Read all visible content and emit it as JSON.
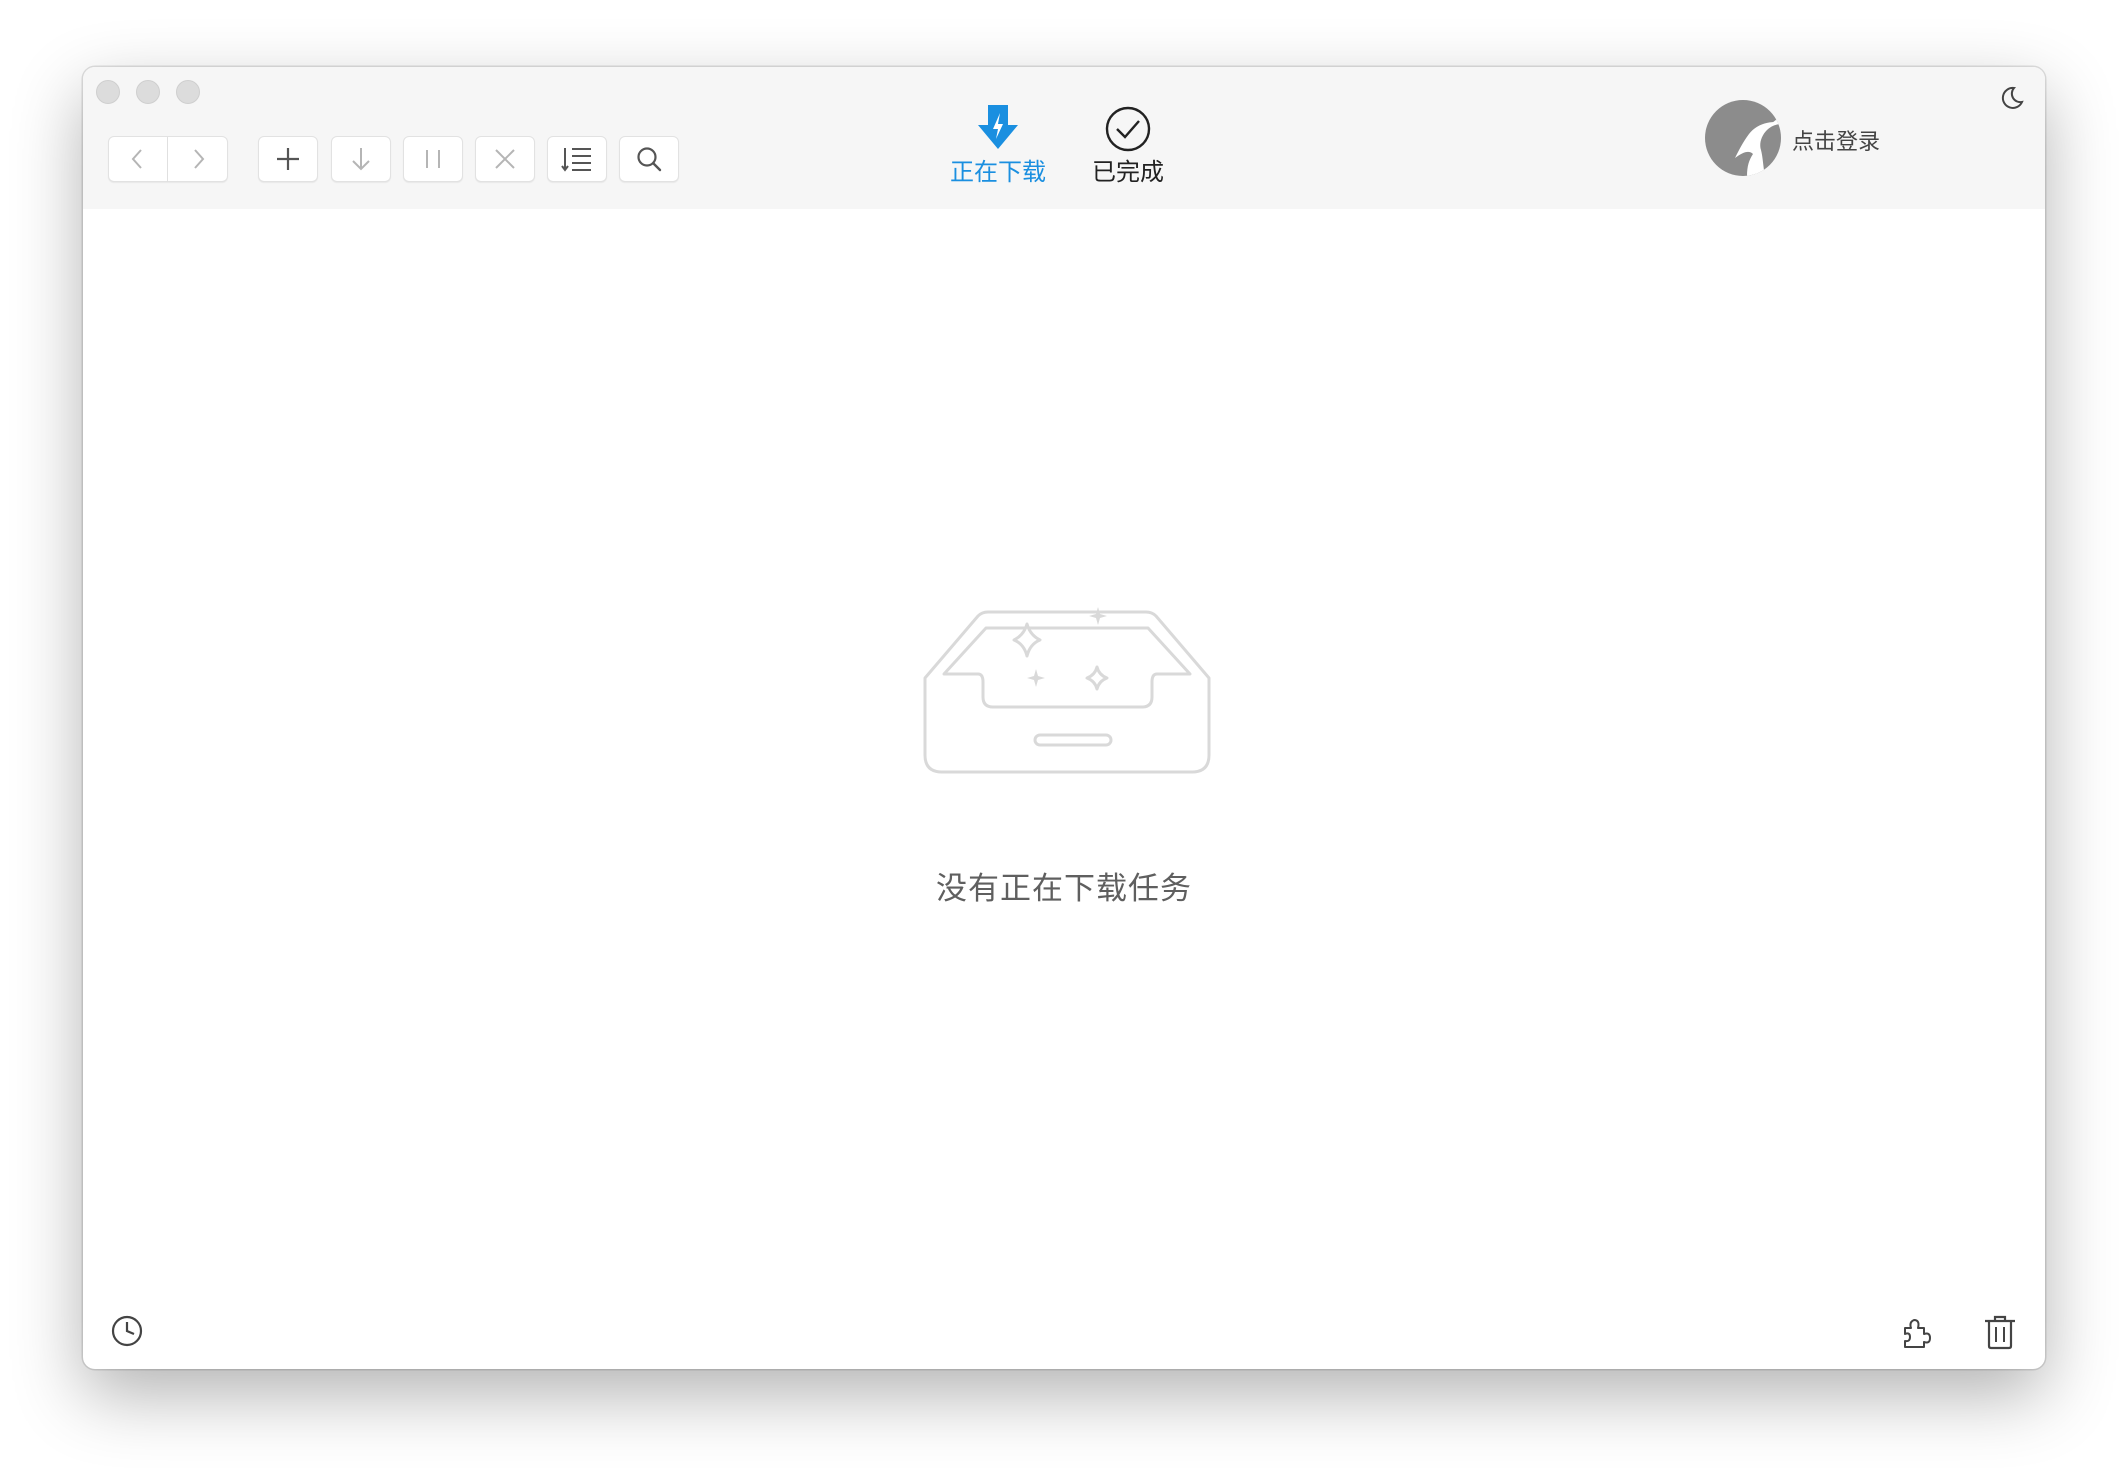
{
  "window": {
    "traffic_lights": [
      "close",
      "minimize",
      "zoom"
    ]
  },
  "toolbar": {
    "back_icon": "chevron-left-icon",
    "forward_icon": "chevron-right-icon",
    "add_icon": "plus-icon",
    "download_icon": "arrow-down-icon",
    "pause_icon": "pause-icon",
    "delete_icon": "close-icon",
    "sort_icon": "list-sort-icon",
    "search_icon": "search-icon"
  },
  "tabs": [
    {
      "label": "正在下载",
      "icon": "download-bolt-icon",
      "active": true,
      "color": "#1a8fe0"
    },
    {
      "label": "已完成",
      "icon": "check-circle-icon",
      "active": false,
      "color": "#222222"
    }
  ],
  "account": {
    "avatar_icon": "hummingbird-avatar",
    "login_label": "点击登录"
  },
  "theme_icon": "moon-icon",
  "empty_state": {
    "illustration": "empty-inbox-illustration",
    "message": "没有正在下载任务"
  },
  "footer": {
    "left_icon": "clock-icon",
    "right_icons": [
      "puzzle-icon",
      "trash-icon"
    ]
  },
  "colors": {
    "accent": "#1a8fe0",
    "titlebar": "#f6f6f6",
    "illustration_stroke": "#d9d9d9"
  }
}
